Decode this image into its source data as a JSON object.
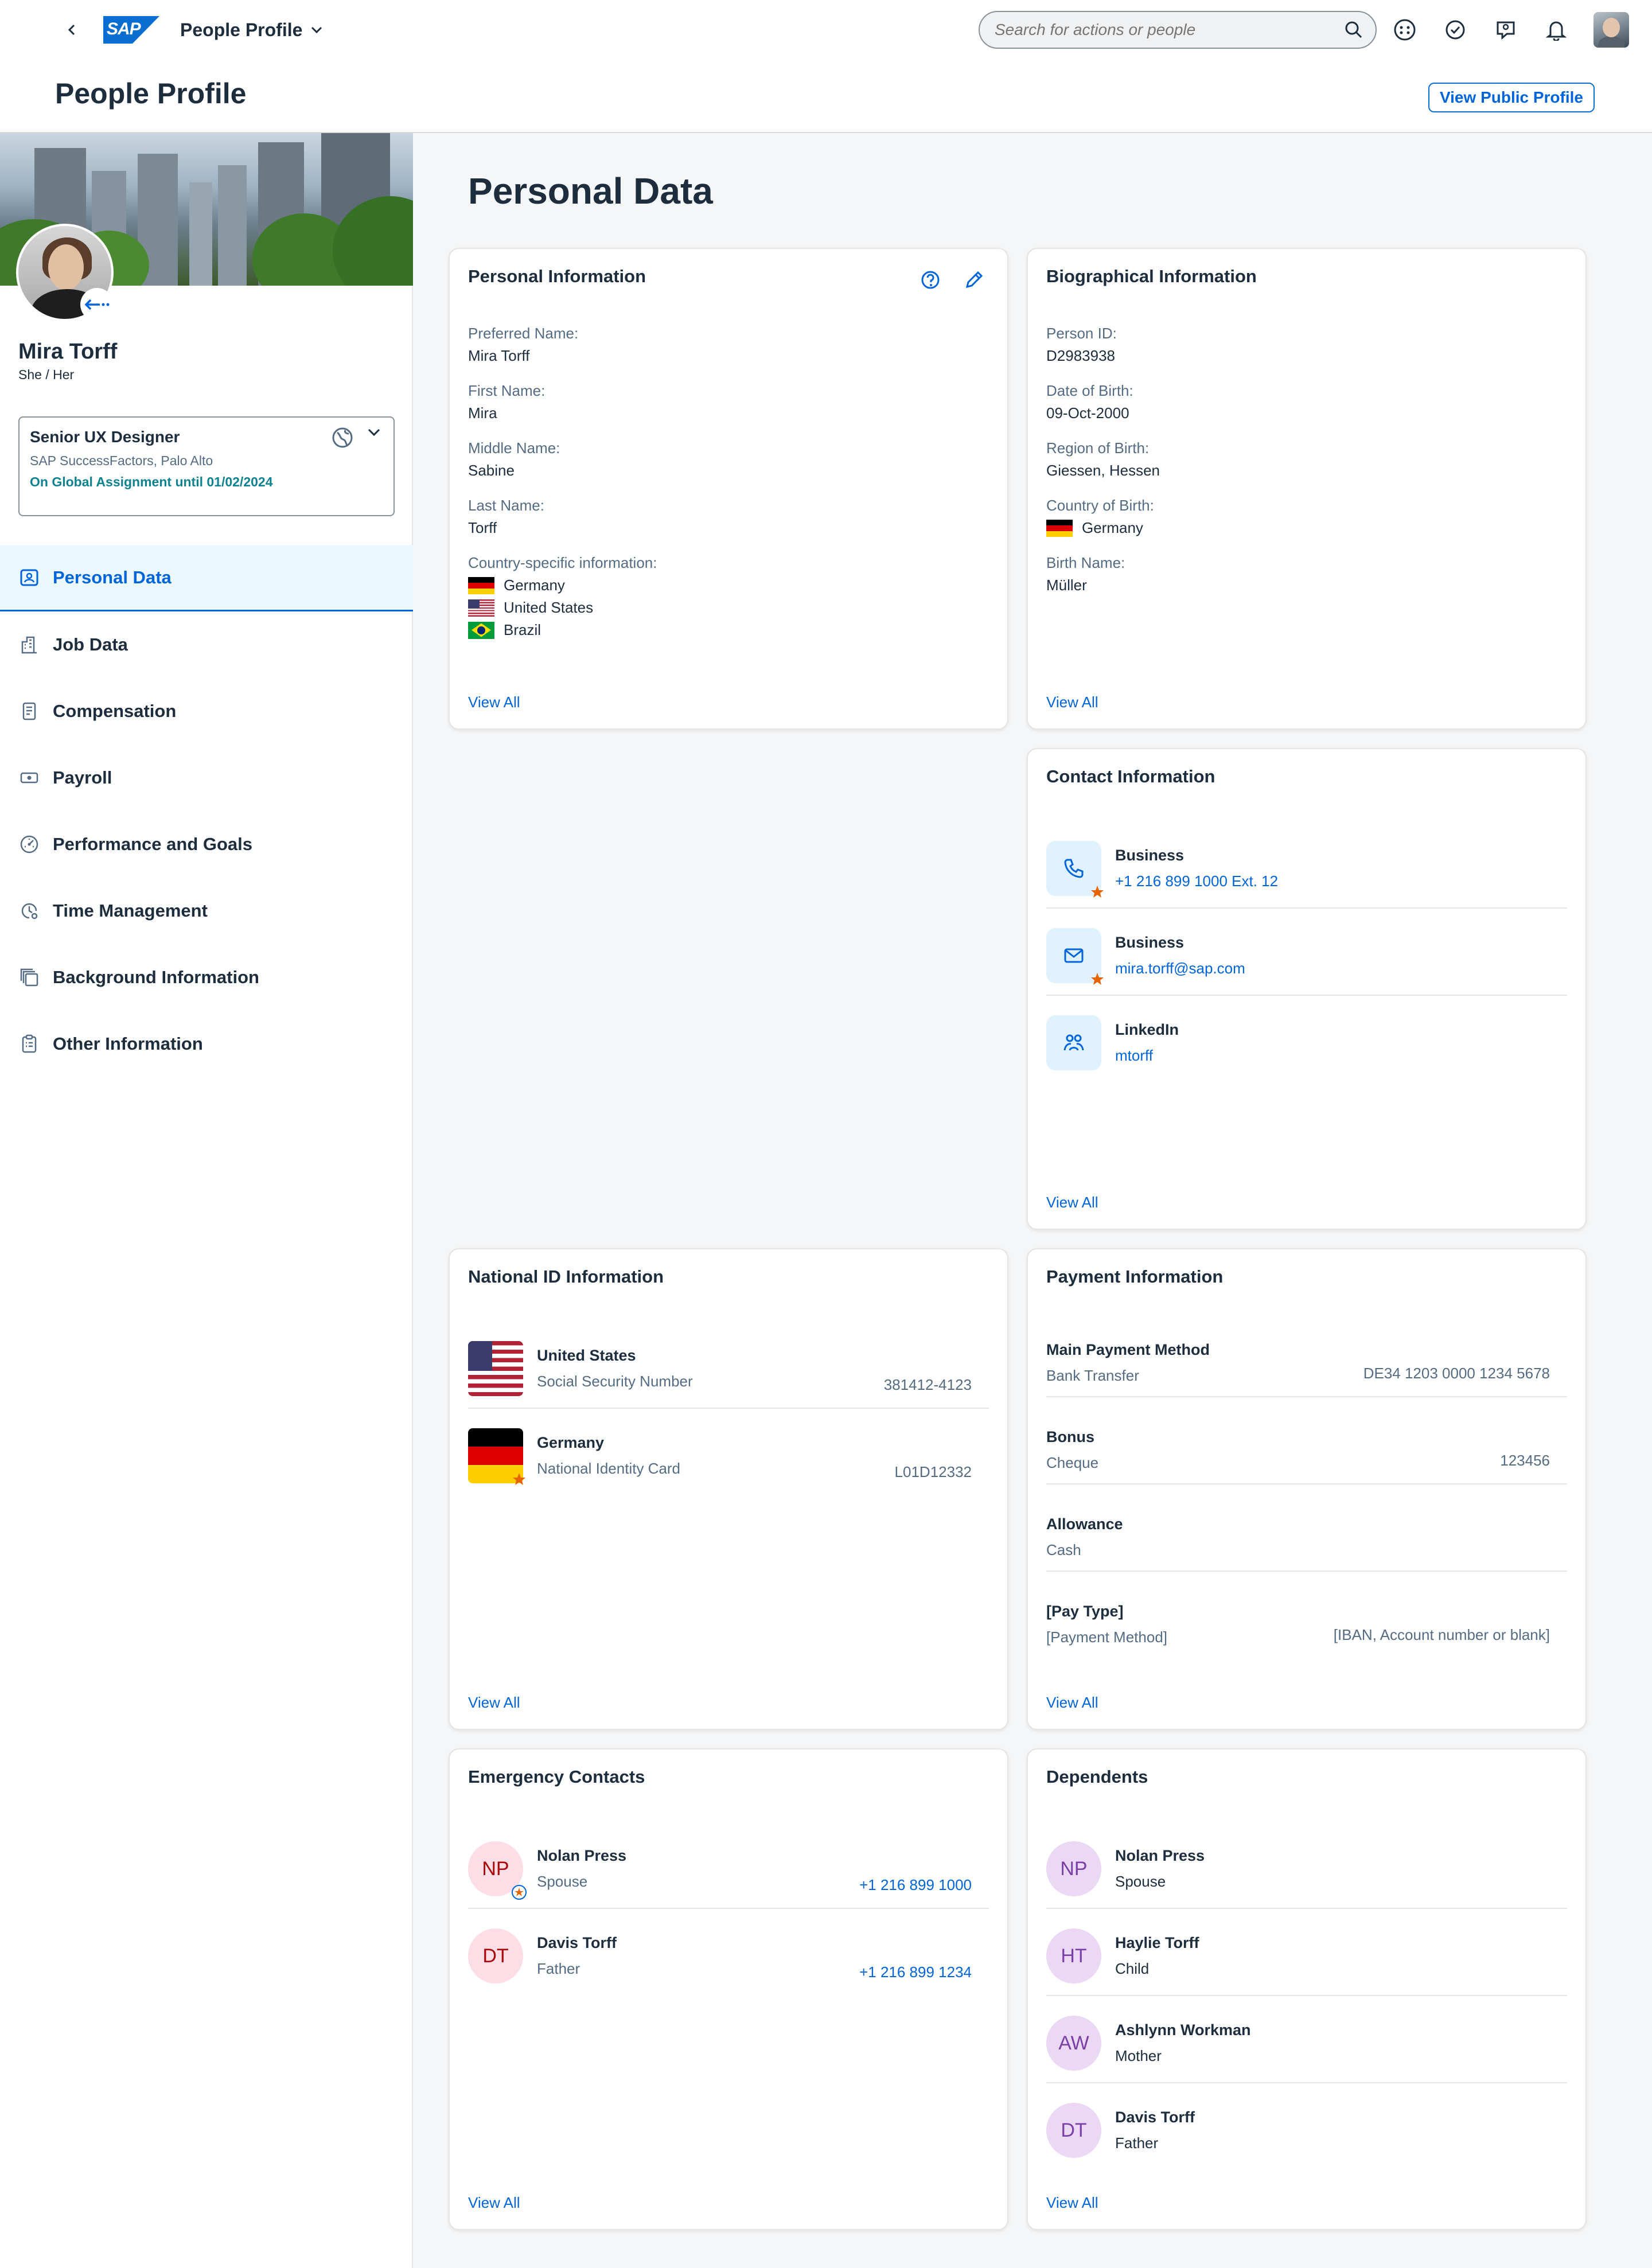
{
  "shell": {
    "logo": "SAP",
    "app_title": "People Profile",
    "search_placeholder": "Search for actions or people"
  },
  "header": {
    "title": "People Profile",
    "view_public_profile": "View Public Profile"
  },
  "profile": {
    "name": "Mira Torff",
    "pronouns": "She / Her",
    "job_title": "Senior UX Designer",
    "organization": "SAP SuccessFactors, Palo Alto",
    "assignment": "On Global Assignment until 01/02/2024"
  },
  "nav": [
    {
      "label": "Personal Data",
      "icon": "person-card-icon",
      "active": true
    },
    {
      "label": "Job Data",
      "icon": "building-icon",
      "active": false
    },
    {
      "label": "Compensation",
      "icon": "document-icon",
      "active": false
    },
    {
      "label": "Payroll",
      "icon": "money-icon",
      "active": false
    },
    {
      "label": "Performance and Goals",
      "icon": "gauge-icon",
      "active": false
    },
    {
      "label": "Time Management",
      "icon": "time-icon",
      "active": false
    },
    {
      "label": "Background Information",
      "icon": "stack-icon",
      "active": false
    },
    {
      "label": "Other Information",
      "icon": "clipboard-icon",
      "active": false
    }
  ],
  "main": {
    "section_title": "Personal Data",
    "view_all": "View All",
    "personal_info": {
      "title": "Personal Information",
      "fields": [
        {
          "label": "Preferred Name:",
          "value": "Mira Torff"
        },
        {
          "label": "First Name:",
          "value": "Mira"
        },
        {
          "label": "Middle Name:",
          "value": "Sabine"
        },
        {
          "label": "Last Name:",
          "value": "Torff"
        }
      ],
      "country_label": "Country-specific information:",
      "countries": [
        "Germany",
        "United States",
        "Brazil"
      ]
    },
    "biographical": {
      "title": "Biographical Information",
      "fields": [
        {
          "label": "Person ID:",
          "value": "D2983938"
        },
        {
          "label": "Date of Birth:",
          "value": "09-Oct-2000"
        },
        {
          "label": "Region of Birth:",
          "value": "Giessen, Hessen"
        },
        {
          "label": "Country of Birth:",
          "value": "Germany"
        },
        {
          "label": "Birth Name:",
          "value": "Müller"
        }
      ]
    },
    "contact": {
      "title": "Contact Information",
      "items": [
        {
          "title": "Business",
          "value": "+1 216 899 1000 Ext. 12"
        },
        {
          "title": "Business",
          "value": "mira.torff@sap.com"
        },
        {
          "title": "LinkedIn",
          "value": "mtorff"
        }
      ]
    },
    "national_id": {
      "title": "National ID Information",
      "items": [
        {
          "country": "United States",
          "type": "Social Security Number",
          "number": "381412-4123"
        },
        {
          "country": "Germany",
          "type": "National Identity Card",
          "number": "L01D12332"
        }
      ]
    },
    "payment": {
      "title": "Payment Information",
      "items": [
        {
          "title": "Main Payment Method",
          "type": "Bank Transfer",
          "detail": "DE34 1203 0000 1234 5678"
        },
        {
          "title": "Bonus",
          "type": "Cheque",
          "detail": "123456"
        },
        {
          "title": "Allowance",
          "type": "Cash",
          "detail": ""
        },
        {
          "title": "[Pay Type]",
          "type": "[Payment Method]",
          "detail": "[IBAN, Account number or blank]"
        }
      ]
    },
    "emergency": {
      "title": "Emergency Contacts",
      "items": [
        {
          "initials": "NP",
          "name": "Nolan Press",
          "relation": "Spouse",
          "phone": "+1 216 899 1000"
        },
        {
          "initials": "DT",
          "name": "Davis Torff",
          "relation": "Father",
          "phone": "+1 216 899 1234"
        }
      ]
    },
    "dependents": {
      "title": "Dependents",
      "items": [
        {
          "initials": "NP",
          "name": "Nolan Press",
          "relation": "Spouse"
        },
        {
          "initials": "HT",
          "name": "Haylie Torff",
          "relation": "Child"
        },
        {
          "initials": "AW",
          "name": "Ashlynn Workman",
          "relation": "Mother"
        },
        {
          "initials": "DT",
          "name": "Davis Torff",
          "relation": "Father"
        }
      ]
    }
  },
  "colors": {
    "accent": "#0064d9",
    "assignment": "#0f828f",
    "star": "#e76500"
  }
}
